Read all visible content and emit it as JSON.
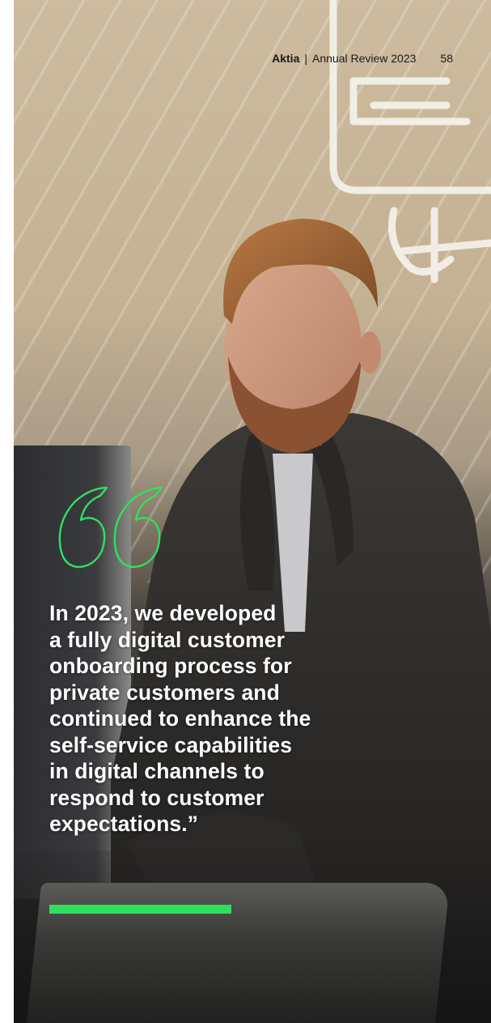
{
  "header": {
    "brand": "Aktia",
    "separator": "|",
    "publication": "Annual Review 2023",
    "page_number": "58"
  },
  "quote": {
    "lines": [
      "In 2023, we developed",
      "a fully digital customer",
      "onboarding process for",
      "private customers and",
      "continued to enhance the",
      "self-service capabilities",
      "in digital channels to",
      "respond to customer",
      "expectations.”"
    ]
  },
  "colors": {
    "accent": "#2fe05f",
    "text_on_photo": "#ffffff",
    "header_text": "#1a1a1a"
  },
  "icons": {
    "quote": "open-quote-outline-icon"
  }
}
